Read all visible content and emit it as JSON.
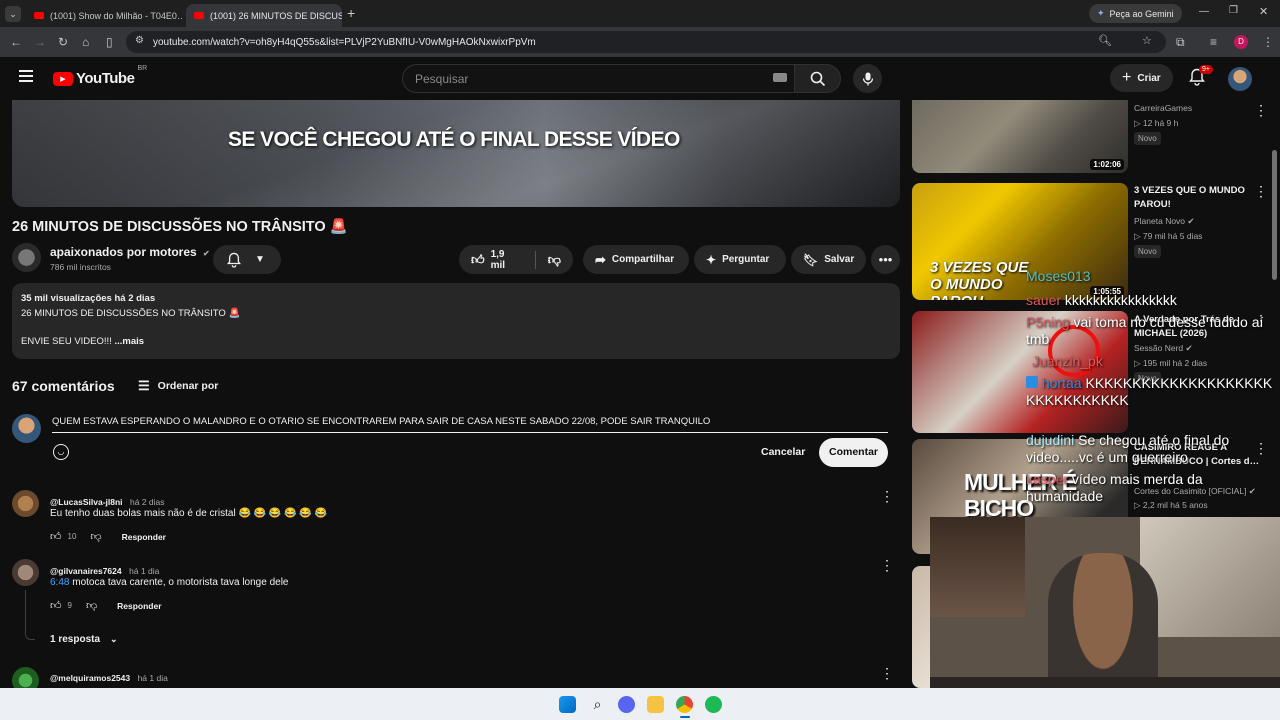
{
  "browser": {
    "tabs": [
      {
        "label": "(1001) Show do Milhão - T04E0…",
        "active": false
      },
      {
        "label": "(1001) 26 MINUTOS DE DISCUS…",
        "active": true
      }
    ],
    "gemini_label": "Peça ao Gemini",
    "url": "youtube.com/watch?v=oh8yH4qQ55s&list=PLVjP2YuBNfIU-V0wMgHAOkNxwixrPpVm",
    "profile_initial": "D"
  },
  "yt": {
    "logo": "YouTube",
    "region": "BR",
    "search_placeholder": "Pesquisar",
    "create_label": "Criar",
    "notif_count": "9+"
  },
  "video": {
    "overlay_text": "SE VOCÊ CHEGOU ATÉ O FINAL DESSE VÍDEO",
    "title": "26 MINUTOS DE DISCUSSÕES NO TRÂNSITO 🚨",
    "channel": "apaixonados por motores",
    "subscribers": "786 mil inscritos",
    "likes": "1,9 mil",
    "share": "Compartilhar",
    "ask": "Perguntar",
    "save": "Salvar",
    "desc_stats": "35 mil visualizações  há 2 dias",
    "desc_line1": "26 MINUTOS DE DISCUSSÕES NO TRÂNSITO 🚨",
    "desc_line2": "ENVIE SEU VIDEO!!!",
    "desc_more": "...mais"
  },
  "comments": {
    "count": "67 comentários",
    "sort": "Ordenar por",
    "draft": "QUEM ESTAVA ESPERANDO O MALANDRO E O OTARIO SE ENCONTRAREM PARA SAIR DE CASA NESTE SABADO 22/08, PODE SAIR TRANQUILO",
    "cancel": "Cancelar",
    "submit": "Comentar",
    "reply_label": "Responder",
    "items": [
      {
        "author": "@LucasSilva-jl8ni",
        "time": "há 2 dias",
        "text": "Eu tenho duas bolas mais não é de cristal 😂 😂 😂 😂 😂 😂",
        "likes": "10",
        "timestamp": ""
      },
      {
        "author": "@gilvanaires7624",
        "time": "há 1 dia",
        "timestamp": "6:48",
        "text": "motoca tava carente, o motorista tava longe dele",
        "likes": "9",
        "replies": "1 resposta"
      },
      {
        "author": "@melquiramos2543",
        "time": "há 1 dia",
        "timestamp": "",
        "text": "",
        "likes": ""
      }
    ]
  },
  "sidebar": [
    {
      "title": "",
      "channel": "CarreiraGames",
      "meta": "▷ 12  há 9 h",
      "badge": "Novo",
      "duration": "1:02:06"
    },
    {
      "title": "3 VEZES QUE O MUNDO PAROU!",
      "channel": "Planeta Novo",
      "meta": "▷ 79 mil  há 5 dias",
      "badge": "Novo",
      "duration": "1:05:55",
      "thumb_text": "3 VEZES QUE O MUNDO PAROU"
    },
    {
      "title": "A Verdade por Trás de MICHAEL (2026)",
      "channel": "Sessão Nerd",
      "meta": "▷ 195 mil  há 2 dias",
      "badge": "Novo",
      "duration": ""
    },
    {
      "title": "CASIMIRO REAGE A PERNAMBUCO | Cortes d…",
      "channel": "Cortes do Casimito [OFICIAL]",
      "meta": "▷ 2,2 mil  há 5 anos",
      "badge": "",
      "duration": "",
      "thumb_text": "MULHER É BICHO RUIM"
    }
  ],
  "chat_overlay": [
    {
      "user": "Moses013",
      "text": ""
    },
    {
      "user": "sauer",
      "text": "kkkkkkkkkkkkkkkk"
    },
    {
      "user": "P5ning",
      "text": "vai toma no cu desse fudido aí tmb"
    },
    {
      "user": "Juanzin_pk",
      "text": ""
    },
    {
      "user": "hortaa",
      "text": "KKKKKKKKKKKKKKKKKKKKKKKKKKKKKKK"
    },
    {
      "user": "dujudini",
      "text": "Se chegou até o final do video.....vc é um guerreiro"
    },
    {
      "user": "kasper",
      "text": "vídeo mais merda da humanidade"
    }
  ],
  "colors": {
    "accent_red": "#ff0000",
    "link_blue": "#3ea6ff",
    "bg": "#0f0f0f",
    "chip": "#272727"
  }
}
